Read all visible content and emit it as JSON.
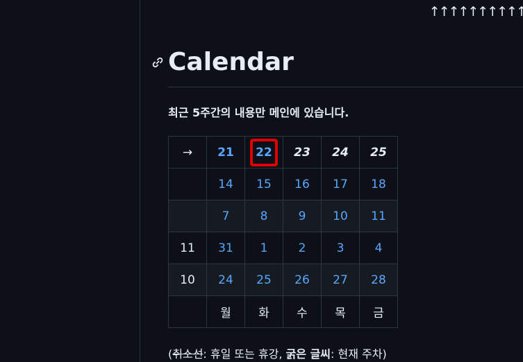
{
  "top": {
    "arrows": "↑↑↑↑↑↑↑↑↑↑"
  },
  "section": {
    "title": "Calendar",
    "intro": "최근 5주간의 내용만 메인에 있습니다."
  },
  "calendar": {
    "rows": [
      [
        "→",
        "21",
        "22",
        "23",
        "24",
        "25"
      ],
      [
        "",
        "14",
        "15",
        "16",
        "17",
        "18"
      ],
      [
        "",
        "7",
        "8",
        "9",
        "10",
        "11"
      ],
      [
        "11",
        "31",
        "1",
        "2",
        "3",
        "4"
      ],
      [
        "10",
        "24",
        "25",
        "26",
        "27",
        "28"
      ],
      [
        "",
        "월",
        "화",
        "수",
        "목",
        "금"
      ]
    ],
    "highlighted_day": "22",
    "colors": {
      "link": "#58a6ff",
      "highlight": "#e00000"
    }
  },
  "legend": {
    "open": "(",
    "strike": "취소선",
    "strike_desc": ": 휴일 또는 휴강, ",
    "bold": "굵은 글씨",
    "bold_desc": ": 현재 주차)"
  }
}
